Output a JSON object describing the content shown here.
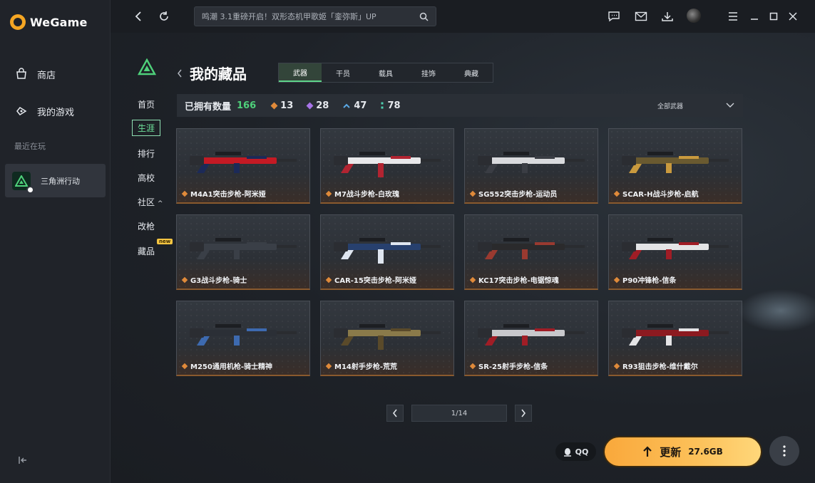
{
  "app": {
    "brand": "WeGame"
  },
  "sidebar": {
    "items": [
      {
        "label": "商店",
        "icon": "store-icon"
      },
      {
        "label": "我的游戏",
        "icon": "gamepad-icon"
      }
    ],
    "recent_label": "最近在玩",
    "recent_game": "三角洲行动"
  },
  "topbar": {
    "search_placeholder": "鸣潮 3.1重磅开启！双形态机甲歌姬「銮弥斯」UP"
  },
  "subnav": [
    "首页",
    "生涯",
    "排行",
    "高校",
    "社区",
    "改枪",
    "藏品"
  ],
  "subnav_community_suffix": "^",
  "new_badge": "new",
  "page": {
    "title": "我的藏品",
    "tabs": [
      "武器",
      "干员",
      "载具",
      "挂饰",
      "典藏"
    ],
    "active_tab": "武器"
  },
  "stats": {
    "own_label": "已拥有数量",
    "own_count": "166",
    "rarities": [
      {
        "value": "13",
        "color": "#e08a3a"
      },
      {
        "value": "28",
        "color": "#a874e8"
      },
      {
        "value": "47",
        "color": "#5aa9e6"
      },
      {
        "value": "78",
        "color": "#4ed0b0"
      }
    ],
    "filter_label": "全部武器"
  },
  "cards": [
    {
      "name": "M4A1突击步枪-阿米娅",
      "tint": "#c41a24",
      "accent": "#1c2a58"
    },
    {
      "name": "M7战斗步枪-白玫瑰",
      "tint": "#e8e8ea",
      "accent": "#b22431"
    },
    {
      "name": "SG552突击步枪-运动员",
      "tint": "#d9dadd",
      "accent": "#3a3d44"
    },
    {
      "name": "SCAR-H战斗步枪-启航",
      "tint": "#6a5a30",
      "accent": "#c99a3e"
    },
    {
      "name": "G3战斗步枪-骑士",
      "tint": "#3a3f47",
      "accent": "#3a3f47"
    },
    {
      "name": "CAR-15突击步枪-阿米娅",
      "tint": "#27406e",
      "accent": "#dfe6f0"
    },
    {
      "name": "KC17突击步枪-电锯惊魂",
      "tint": "#2a2a2c",
      "accent": "#9a3a30"
    },
    {
      "name": "P90冲锋枪-信条",
      "tint": "#e4e4e6",
      "accent": "#a01d26"
    },
    {
      "name": "M250通用机枪-骑士精神",
      "tint": "#2b2f36",
      "accent": "#3d6ab0"
    },
    {
      "name": "M14射手步枪-荒荒",
      "tint": "#8a7a4a",
      "accent": "#5a4a2a"
    },
    {
      "name": "SR-25射手步枪-信条",
      "tint": "#c8c8cc",
      "accent": "#a01d26"
    },
    {
      "name": "R93狙击步枪-维什戴尔",
      "tint": "#8c1a20",
      "accent": "#e4e4e6"
    }
  ],
  "pagination": {
    "label": "1/14"
  },
  "bottom": {
    "qq_label": "QQ",
    "update_label": "更新",
    "update_size": "27.6GB"
  }
}
